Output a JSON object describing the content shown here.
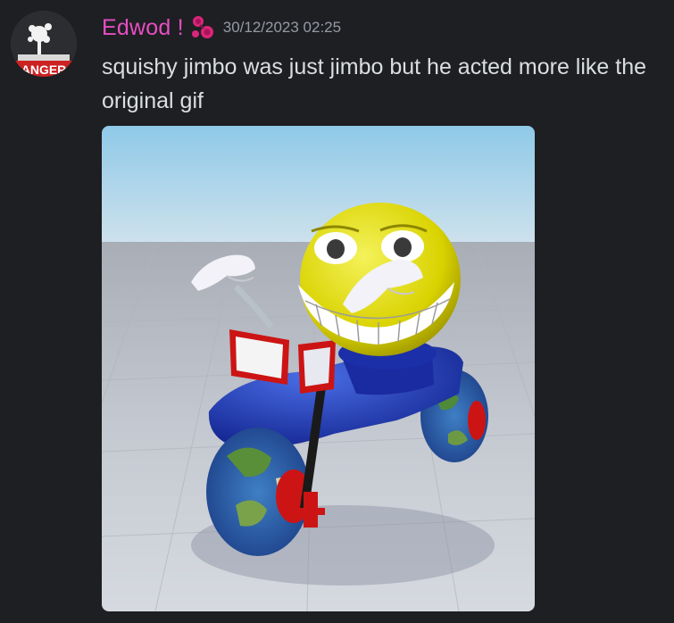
{
  "message": {
    "author": {
      "username": "Edwod !",
      "avatar_icon": "danger-sign-avatar-icon",
      "role_icon": "red-roses-icon",
      "username_color": "#e64ec3"
    },
    "timestamp": "30/12/2023 02:25",
    "text": "squishy jimbo was just jimbo but he acted more like the original gif",
    "attachment": {
      "type": "image",
      "description_icon": "jimbo-on-tricycle-image"
    }
  },
  "colors": {
    "background": "#1e1f22",
    "text": "#dbdee1",
    "timestamp": "#949ba4"
  }
}
